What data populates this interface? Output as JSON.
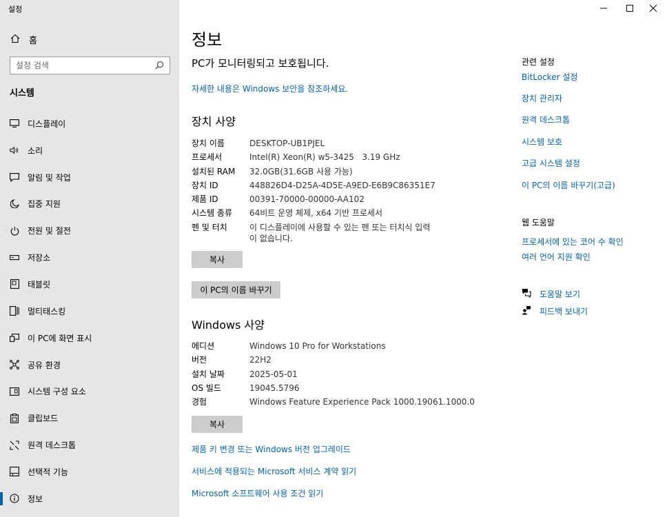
{
  "app": {
    "title": "설정"
  },
  "window": {
    "minimize": "—",
    "maximize": "☐",
    "close": "✕"
  },
  "sidebar": {
    "home_label": "홈",
    "search_placeholder": "설정 검색",
    "section": "시스템",
    "items": [
      {
        "label": "디스플레이",
        "icon": "display-icon"
      },
      {
        "label": "소리",
        "icon": "speaker-icon"
      },
      {
        "label": "알림 및 작업",
        "icon": "notification-icon"
      },
      {
        "label": "집중 지원",
        "icon": "moon-icon"
      },
      {
        "label": "전원 및 절전",
        "icon": "power-icon"
      },
      {
        "label": "저장소",
        "icon": "storage-icon"
      },
      {
        "label": "태블릿",
        "icon": "tablet-icon"
      },
      {
        "label": "멀티태스킹",
        "icon": "multitasking-icon"
      },
      {
        "label": "이 PC에 화면 표시",
        "icon": "project-icon"
      },
      {
        "label": "공유 환경",
        "icon": "shared-icon"
      },
      {
        "label": "시스템 구성 요소",
        "icon": "components-icon"
      },
      {
        "label": "클립보드",
        "icon": "clipboard-icon"
      },
      {
        "label": "원격 데스크톱",
        "icon": "remote-icon"
      },
      {
        "label": "선택적 기능",
        "icon": "features-icon"
      },
      {
        "label": "정보",
        "icon": "info-icon"
      }
    ]
  },
  "main": {
    "title": "정보",
    "protect_text": "PC가 모니터링되고 보호됩니다.",
    "security_link": "자세한 내용은 Windows 보안을 참조하세요.",
    "device_heading": "장치 사양",
    "device_specs": [
      {
        "key": "장치 이름",
        "value": "DESKTOP-UB1PJEL"
      },
      {
        "key": "프로세서",
        "value": "Intel(R) Xeon(R) w5-3425   3.19 GHz"
      },
      {
        "key": "설치된 RAM",
        "value": "32.0GB(31.6GB 사용 가능)"
      },
      {
        "key": "장치 ID",
        "value": "448826D4-D25A-4D5E-A9ED-E6B9C86351E7"
      },
      {
        "key": "제품 ID",
        "value": "00391-70000-00000-AA102"
      },
      {
        "key": "시스템 종류",
        "value": "64비트 운영 체제, x64 기반 프로세서"
      },
      {
        "key": "펜 및 터치",
        "value": "이 디스플레이에 사용할 수 있는 펜 또는 터치식 입력이 없습니다."
      }
    ],
    "copy_label": "복사",
    "rename_label": "이 PC의 이름 바꾸기",
    "windows_heading": "Windows 사양",
    "windows_specs": [
      {
        "key": "에디션",
        "value": "Windows 10 Pro for Workstations"
      },
      {
        "key": "버전",
        "value": "22H2"
      },
      {
        "key": "설치 날짜",
        "value": "2025-05-01"
      },
      {
        "key": "OS 빌드",
        "value": "19045.5796"
      },
      {
        "key": "경험",
        "value": "Windows Feature Experience Pack 1000.19061.1000.0"
      }
    ],
    "copy2_label": "복사",
    "links": [
      "제품 키 변경 또는 Windows 버전 업그레이드",
      "서비스에 적용되는 Microsoft 서비스 계약 읽기",
      "Microsoft 소프트웨어 사용 조건 읽기"
    ]
  },
  "right": {
    "related_heading": "관련 설정",
    "related_links": [
      "BitLocker 설정",
      "장치 관리자",
      "원격 데스크톱",
      "시스템 보호",
      "고급 시스템 설정",
      "이 PC의 이름 바꾸기(고급)"
    ],
    "web_help_heading": "웹 도움말",
    "web_help_links": [
      "프로세서에 있는 코어 수 확인",
      "여러 언어 지원 확인"
    ],
    "help_label": "도움말 보기",
    "feedback_label": "피드백 보내기"
  }
}
